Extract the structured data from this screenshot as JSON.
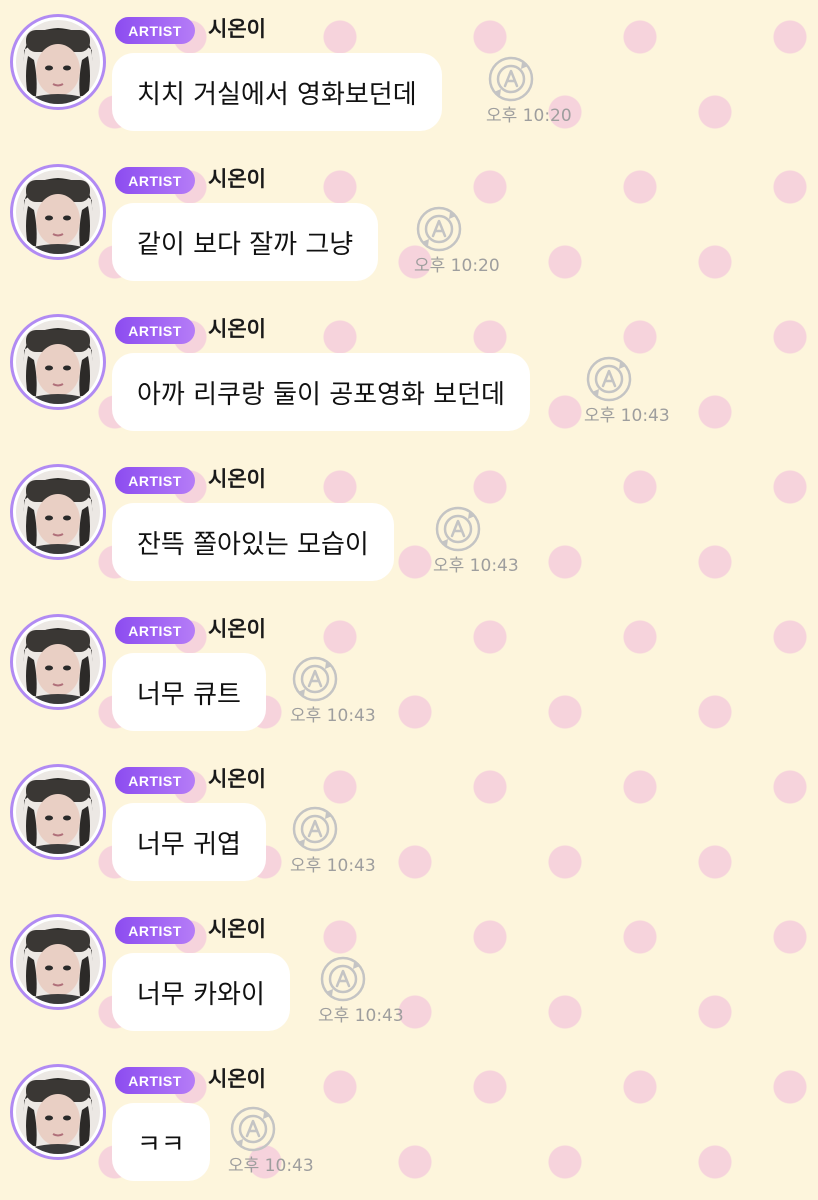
{
  "messages": [
    {
      "badge": "ARTIST",
      "sender": "시온이",
      "text": "치치 거실에서 영화보던데",
      "time": "오후 10:20"
    },
    {
      "badge": "ARTIST",
      "sender": "시온이",
      "text": "같이 보다 잘까 그냥",
      "time": "오후 10:20"
    },
    {
      "badge": "ARTIST",
      "sender": "시온이",
      "text": "아까 리쿠랑 둘이 공포영화 보던데",
      "time": "오후 10:43"
    },
    {
      "badge": "ARTIST",
      "sender": "시온이",
      "text": "잔뜩 쫄아있는 모습이",
      "time": "오후 10:43"
    },
    {
      "badge": "ARTIST",
      "sender": "시온이",
      "text": "너무 큐트",
      "time": "오후 10:43"
    },
    {
      "badge": "ARTIST",
      "sender": "시온이",
      "text": "너무 귀엽",
      "time": "오후 10:43"
    },
    {
      "badge": "ARTIST",
      "sender": "시온이",
      "text": "너무 카와이",
      "time": "오후 10:43"
    },
    {
      "badge": "ARTIST",
      "sender": "시온이",
      "text": "ㅋㅋ",
      "time": "오후 10:43"
    }
  ],
  "icons": {
    "avatar": "avatar-photo",
    "translate": "translate-icon"
  },
  "colors": {
    "background": "#fdf5dc",
    "dots": "#f6d3dc",
    "badge": "#9b5cf4",
    "avatar_ring": "#b18af3",
    "time": "#9e9e9e"
  }
}
